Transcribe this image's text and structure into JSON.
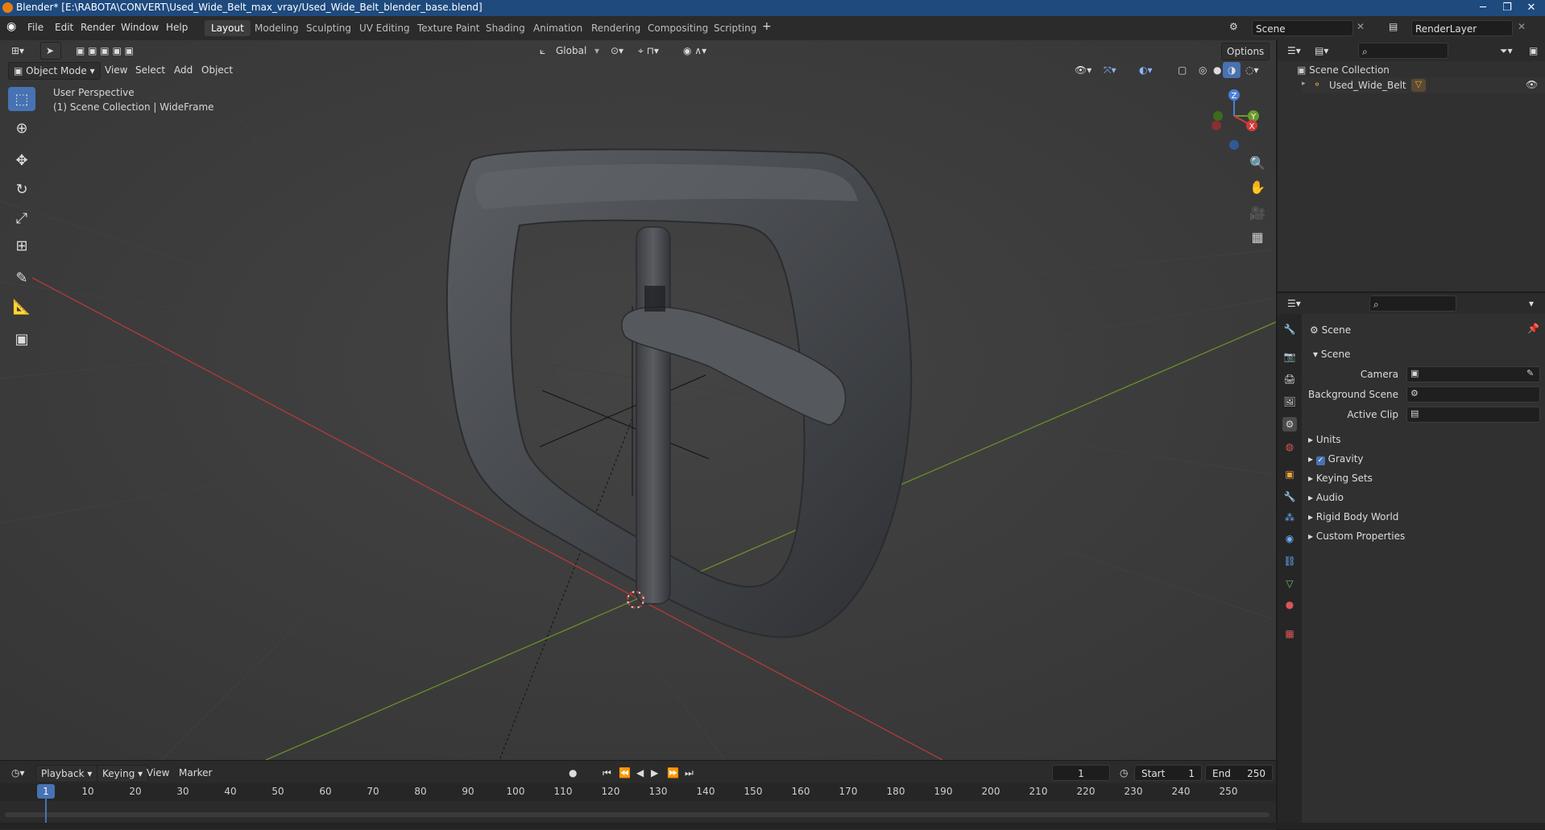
{
  "window": {
    "title": "Blender* [E:\\RABOTA\\CONVERT\\Used_Wide_Belt_max_vray/Used_Wide_Belt_blender_base.blend]",
    "minimize": "─",
    "maximize": "❐",
    "close": "✕"
  },
  "menubar": {
    "items": [
      "File",
      "Edit",
      "Render",
      "Window",
      "Help"
    ],
    "workspaces": [
      "Layout",
      "Modeling",
      "Sculpting",
      "UV Editing",
      "Texture Paint",
      "Shading",
      "Animation",
      "Rendering",
      "Compositing",
      "Scripting"
    ],
    "active_workspace": "Layout",
    "add_workspace": "+",
    "scene_field": "Scene",
    "renderlayer_field": "RenderLayer"
  },
  "viewport": {
    "header": {
      "transform_orientation": "Global",
      "options": "Options"
    },
    "tool_header": {
      "mode": "Object Mode",
      "menus": [
        "View",
        "Select",
        "Add",
        "Object"
      ]
    },
    "overlay_text": {
      "perspective": "User Perspective",
      "collection": "(1) Scene Collection | WideFrame"
    },
    "gizmo": {
      "z": "Z",
      "y": "Y",
      "x": "X"
    }
  },
  "outliner": {
    "root": "Scene Collection",
    "items": [
      {
        "label": "Used_Wide_Belt"
      }
    ]
  },
  "properties": {
    "title": "Scene",
    "section": "Scene",
    "fields": [
      {
        "label": "Camera"
      },
      {
        "label": "Background Scene"
      },
      {
        "label": "Active Clip"
      }
    ],
    "panels": [
      "Units",
      "Gravity",
      "Keying Sets",
      "Audio",
      "Rigid Body World",
      "Custom Properties"
    ],
    "gravity_checked": true
  },
  "timeline": {
    "menus": [
      "Playback",
      "Keying",
      "View",
      "Marker"
    ],
    "current_frame": "1",
    "start_label": "Start",
    "start": "1",
    "end_label": "End",
    "end": "250",
    "ticks": [
      "1",
      "10",
      "20",
      "30",
      "40",
      "50",
      "60",
      "70",
      "80",
      "90",
      "100",
      "110",
      "120",
      "130",
      "140",
      "150",
      "160",
      "170",
      "180",
      "190",
      "200",
      "210",
      "220",
      "230",
      "240",
      "250"
    ]
  },
  "colors": {
    "accent": "#4772b3",
    "titlebar": "#1e4a7e",
    "viewport_bg": "#3b3b3b",
    "axis_x": "#b33a3a",
    "axis_y": "#6a8f2a",
    "buckle": "#4a4d52"
  }
}
